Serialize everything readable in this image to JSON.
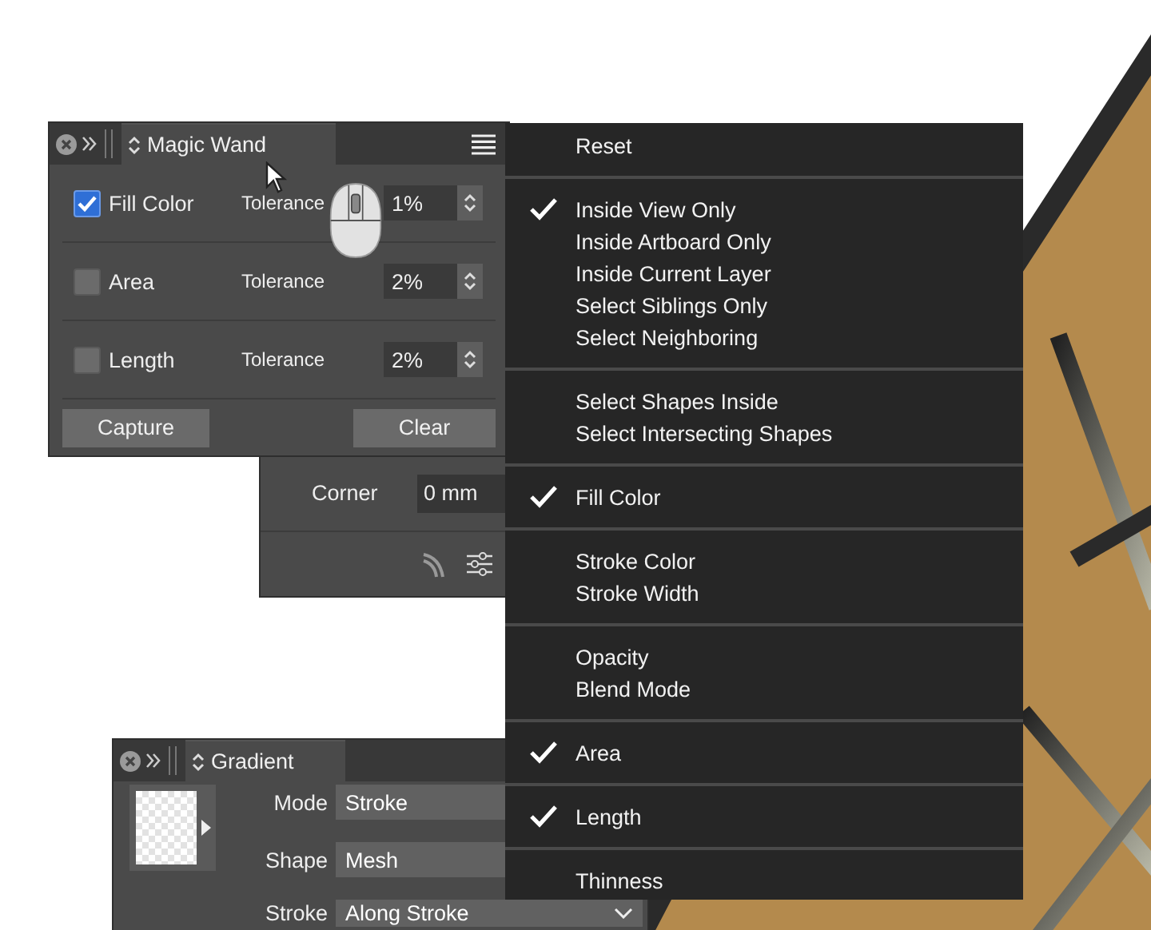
{
  "magic_wand_panel": {
    "title": "Magic Wand",
    "rows": [
      {
        "label": "Fill Color",
        "checked": true,
        "tolerance_label": "Tolerance",
        "value": "1%"
      },
      {
        "label": "Area",
        "checked": false,
        "tolerance_label": "Tolerance",
        "value": "2%"
      },
      {
        "label": "Length",
        "checked": false,
        "tolerance_label": "Tolerance",
        "value": "2%"
      }
    ],
    "buttons": [
      "Capture",
      "Clear"
    ]
  },
  "stroke_panel": {
    "corner_label": "Corner",
    "corner_value": "0 mm"
  },
  "menu": {
    "groups": [
      {
        "items": [
          {
            "label": "Reset",
            "checked": false
          }
        ]
      },
      {
        "items": [
          {
            "label": "Inside View Only",
            "checked": true
          },
          {
            "label": "Inside Artboard Only",
            "checked": false
          },
          {
            "label": "Inside Current Layer",
            "checked": false
          },
          {
            "label": "Select Siblings Only",
            "checked": false
          },
          {
            "label": "Select Neighboring",
            "checked": false
          }
        ]
      },
      {
        "items": [
          {
            "label": "Select Shapes Inside",
            "checked": false
          },
          {
            "label": "Select Intersecting Shapes",
            "checked": false
          }
        ]
      },
      {
        "items": [
          {
            "label": "Fill Color",
            "checked": true
          }
        ]
      },
      {
        "items": [
          {
            "label": "Stroke Color",
            "checked": false
          },
          {
            "label": "Stroke Width",
            "checked": false
          }
        ]
      },
      {
        "items": [
          {
            "label": "Opacity",
            "checked": false
          },
          {
            "label": "Blend Mode",
            "checked": false
          }
        ]
      },
      {
        "items": [
          {
            "label": "Area",
            "checked": true
          }
        ]
      },
      {
        "items": [
          {
            "label": "Length",
            "checked": true
          }
        ]
      },
      {
        "items": [
          {
            "label": "Thinness",
            "checked": false
          }
        ]
      }
    ]
  },
  "gradient_panel": {
    "title": "Gradient",
    "fields": [
      {
        "label": "Mode",
        "value": "Stroke",
        "kind": "text"
      },
      {
        "label": "Shape",
        "value": "Mesh",
        "kind": "text"
      },
      {
        "label": "Stroke",
        "value": "Along Stroke",
        "kind": "dropdown"
      }
    ]
  }
}
